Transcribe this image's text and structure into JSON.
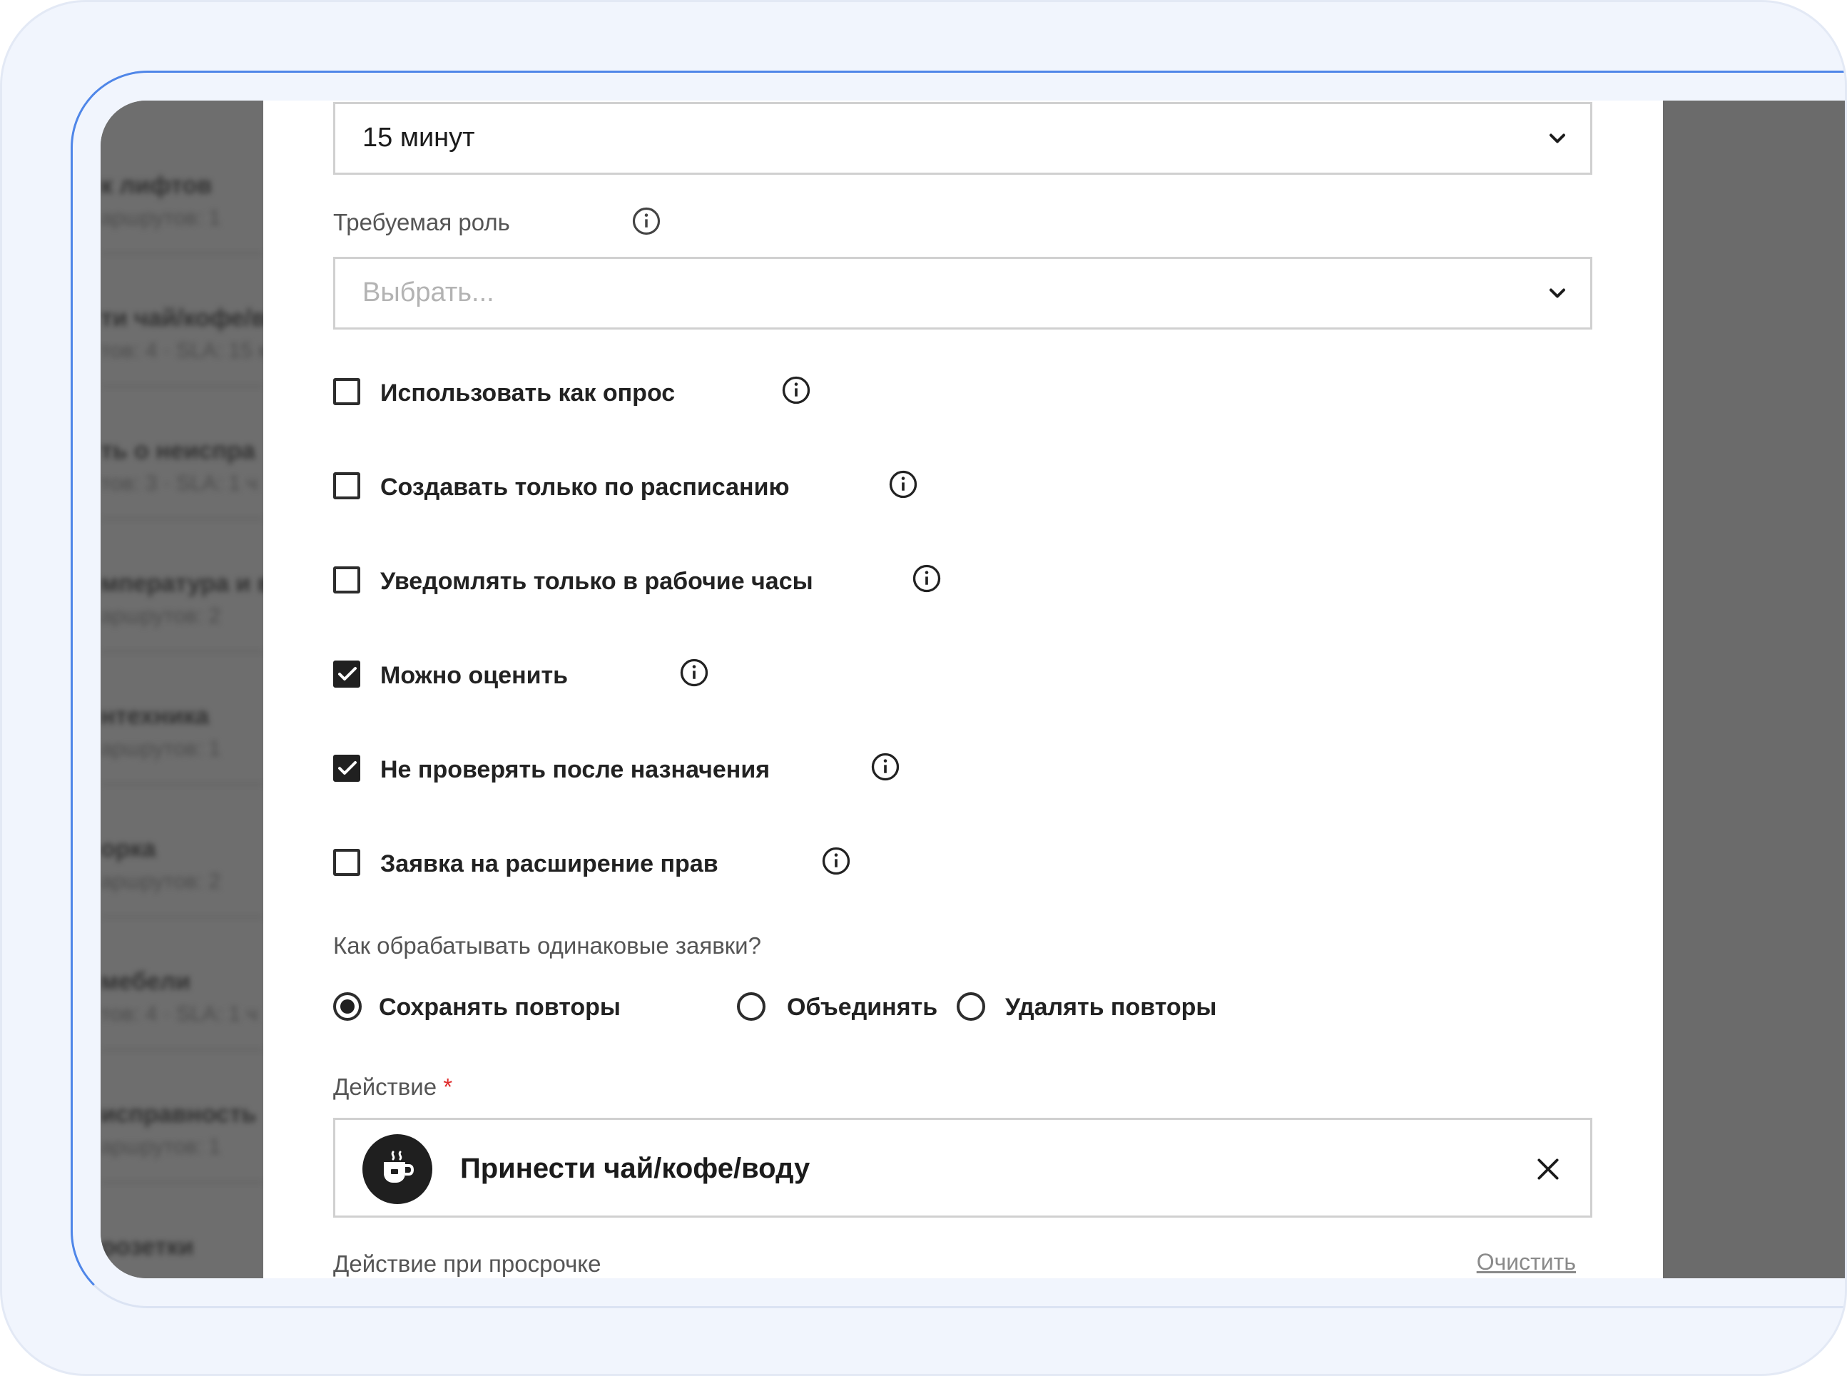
{
  "background_list": {
    "items": [
      {
        "title": "к лифтов",
        "subtitle": "аршрутов: 1"
      },
      {
        "title": "ти чай/кофе/в",
        "subtitle": "тов: 4 · SLA: 15 м"
      },
      {
        "title": "ть о неиспра",
        "subtitle": "тов: 3 · SLA: 1 ч"
      },
      {
        "title": "мпература и в",
        "subtitle": "аршрутов: 2"
      },
      {
        "title": "нтехника",
        "subtitle": "аршрутов: 1"
      },
      {
        "title": "орка",
        "subtitle": "аршрутов: 2"
      },
      {
        "title": "мебели",
        "subtitle": "тов: 4 · SLA: 1 ч"
      },
      {
        "title": "исправность",
        "subtitle": "аршрутов: 1"
      },
      {
        "title": "розетки",
        "subtitle": ""
      }
    ]
  },
  "form": {
    "duration_select": {
      "value": "15 минут"
    },
    "role": {
      "label": "Требуемая роль",
      "placeholder": "Выбрать..."
    },
    "checkboxes": [
      {
        "label": "Использовать как опрос",
        "checked": false
      },
      {
        "label": "Создавать только по расписанию",
        "checked": false
      },
      {
        "label": "Уведомлять только в рабочие часы",
        "checked": false
      },
      {
        "label": "Можно оценить",
        "checked": true
      },
      {
        "label": "Не проверять после назначения",
        "checked": true
      },
      {
        "label": "Заявка на расширение прав",
        "checked": false
      }
    ],
    "duplicates": {
      "question": "Как обрабатывать одинаковые заявки?",
      "options": [
        {
          "label": "Сохранять повторы",
          "selected": true
        },
        {
          "label": "Объединять",
          "selected": false
        },
        {
          "label": "Удалять повторы",
          "selected": false
        }
      ]
    },
    "action": {
      "label": "Действие",
      "required_mark": "*",
      "value": "Принести чай/кофе/воду",
      "icon": "coffee-cup-icon"
    },
    "overdue_action": {
      "label": "Действие при просрочке",
      "clear_label": "Очистить"
    }
  },
  "colors": {
    "frame_bg": "#f1f5fd",
    "frame_accent": "#4f86e8",
    "overlay": "#6b6b6b",
    "required": "#e02d2d",
    "checked": "#202020"
  }
}
